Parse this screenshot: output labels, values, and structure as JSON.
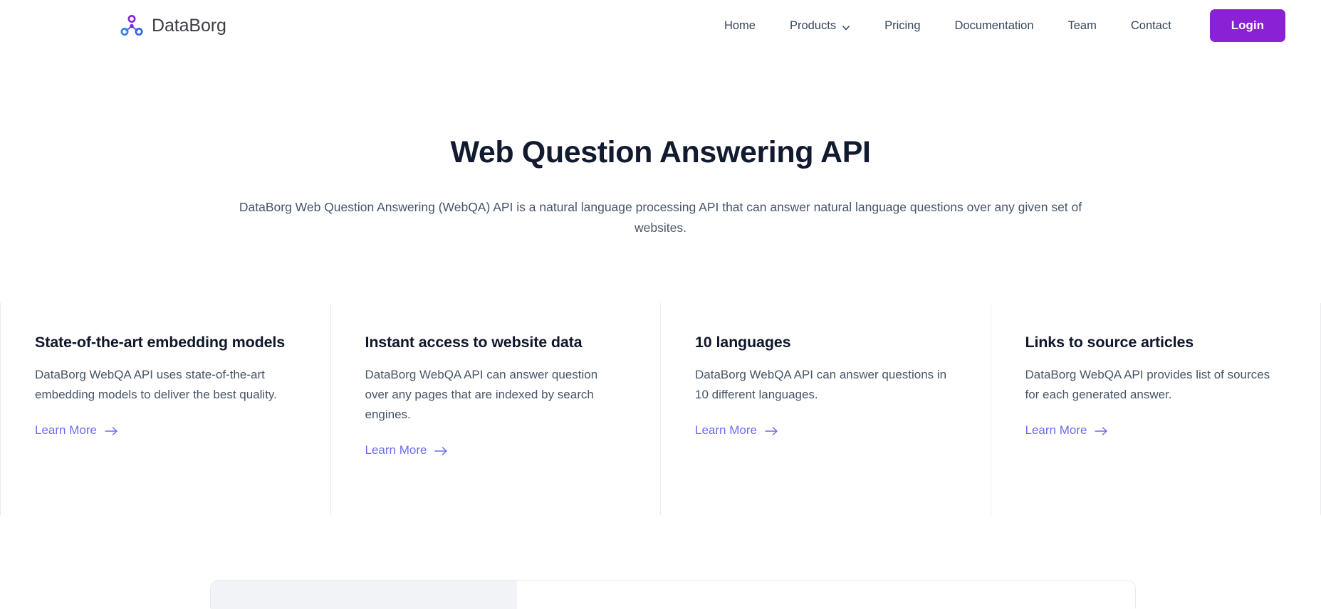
{
  "header": {
    "brand": {
      "name": "DataBorg",
      "logo_icon": "node-graph-icon",
      "colors": {
        "top_node": "#8b21d4",
        "bottom_nodes": "#2f80ed"
      }
    },
    "nav": [
      {
        "label": "Home",
        "icon": null
      },
      {
        "label": "Products",
        "icon": "chevron-down-icon"
      },
      {
        "label": "Pricing",
        "icon": null
      },
      {
        "label": "Documentation",
        "icon": null
      },
      {
        "label": "Team",
        "icon": null
      },
      {
        "label": "Contact",
        "icon": null
      }
    ],
    "login_label": "Login",
    "login_color": "#8b21d4"
  },
  "hero": {
    "title": "Web Question Answering API",
    "subtitle": "DataBorg Web Question Answering (WebQA) API is a natural language processing API that can answer natural language questions over any given set of websites."
  },
  "features": [
    {
      "title": "State-of-the-art embedding models",
      "description": "DataBorg WebQA API uses state-of-the-art embedding models to deliver the best quality.",
      "link_label": "Learn More",
      "link_icon": "arrow-right-icon"
    },
    {
      "title": "Instant access to website data",
      "description": "DataBorg WebQA API can answer question over any pages that are indexed by search engines.",
      "link_label": "Learn More",
      "link_icon": "arrow-right-icon"
    },
    {
      "title": "10 languages",
      "description": "DataBorg WebQA API can answer questions in 10 different languages.",
      "link_label": "Learn More",
      "link_icon": "arrow-right-icon"
    },
    {
      "title": "Links to source articles",
      "description": "DataBorg WebQA API provides list of sources for each generated answer.",
      "link_label": "Learn More",
      "link_icon": "arrow-right-icon"
    }
  ],
  "link_color": "#6c6cf0"
}
